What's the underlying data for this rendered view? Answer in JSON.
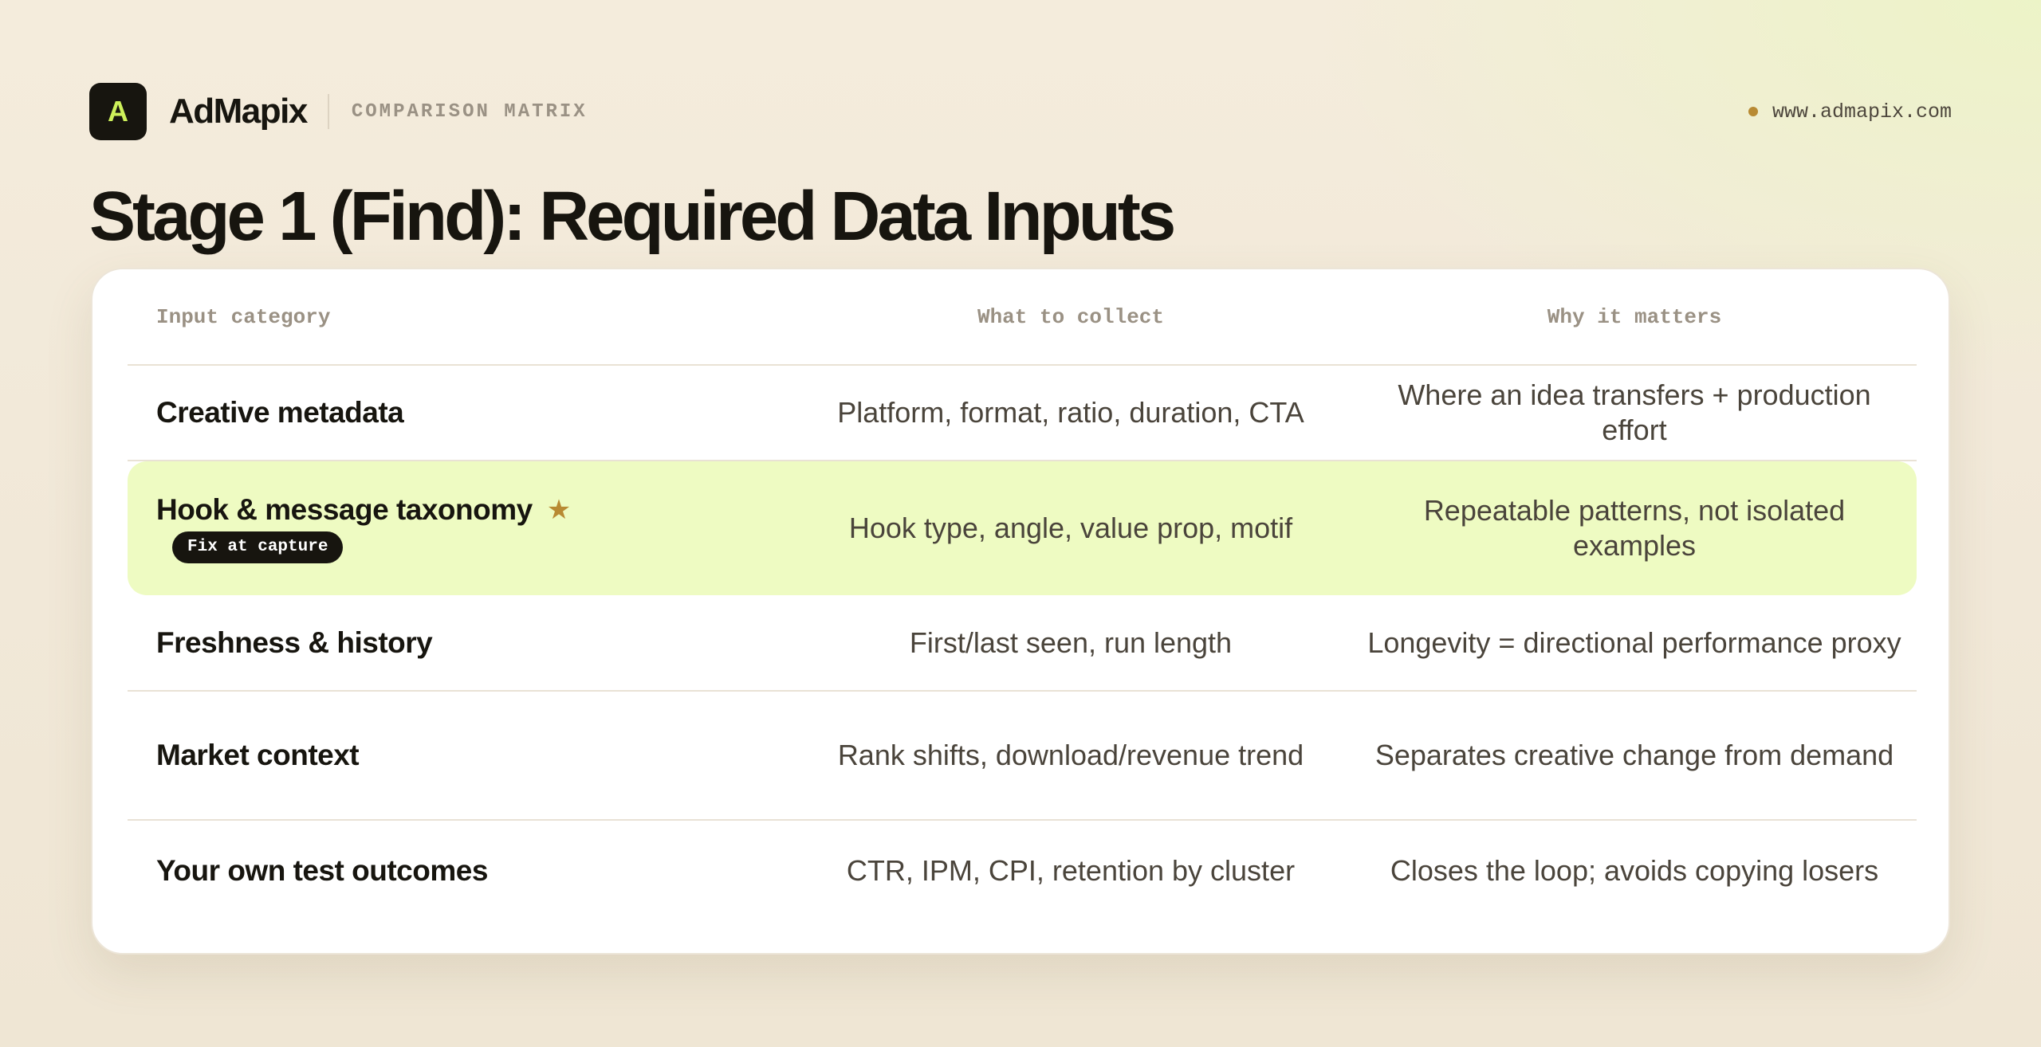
{
  "header": {
    "logo_letter": "A",
    "brand": "AdMapix",
    "section": "COMPARISON MATRIX",
    "url": "www.admapix.com"
  },
  "title": "Stage 1 (Find): Required Data Inputs",
  "colors": {
    "accent": "#cdf05a",
    "highlight_row": "#eefbc2",
    "star": "#b88a33",
    "ink": "#17150f"
  },
  "table": {
    "headers": [
      "Input category",
      "What to collect",
      "Why it matters"
    ],
    "rows": [
      {
        "category": "Creative metadata",
        "collect": "Platform, format, ratio, duration, CTA",
        "why": "Where an idea transfers + production effort"
      },
      {
        "category": "Hook & message taxonomy",
        "badge": "Fix at capture",
        "icon": "star-icon",
        "highlighted": true,
        "collect": "Hook type, angle, value prop, motif",
        "why": "Repeatable patterns, not isolated examples"
      },
      {
        "category": "Freshness & history",
        "collect": "First/last seen, run length",
        "why": "Longevity = directional performance proxy"
      },
      {
        "category": "Market context",
        "collect": "Rank shifts, download/revenue trend",
        "why": "Separates creative change from demand"
      },
      {
        "category": "Your own test outcomes",
        "collect": "CTR, IPM, CPI, retention by cluster",
        "why": "Closes the loop; avoids copying losers"
      }
    ]
  }
}
